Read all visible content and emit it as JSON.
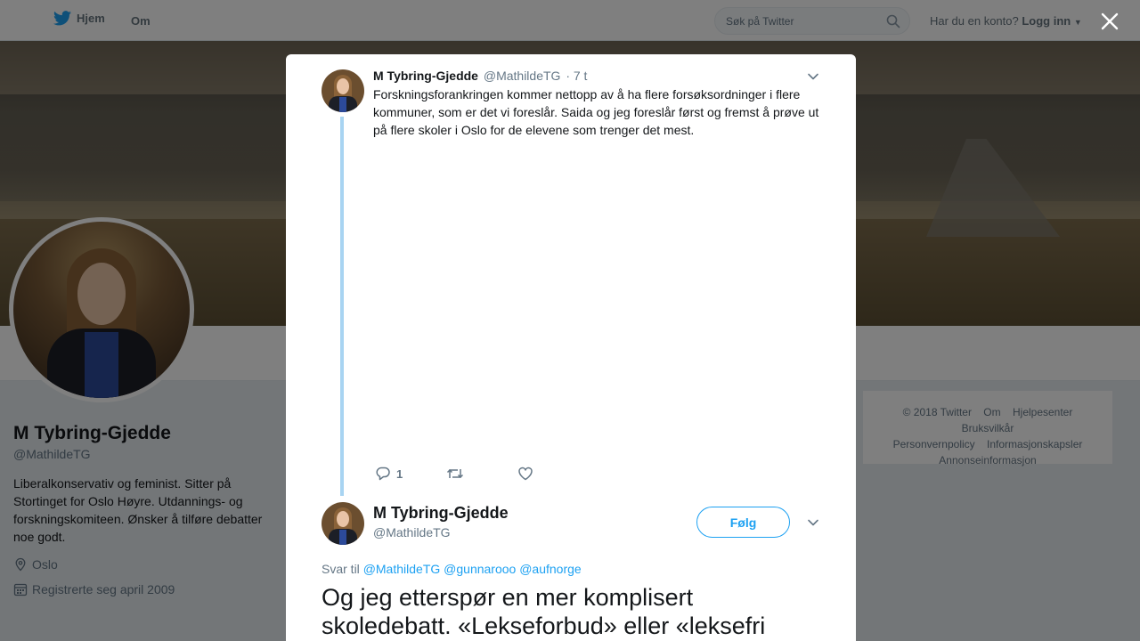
{
  "nav": {
    "home_label": "Hjem",
    "about_label": "Om",
    "search_placeholder": "Søk på Twitter",
    "account_prompt": "Har du en konto?",
    "login_label": "Logg inn"
  },
  "profile": {
    "name": "M Tybring-Gjedde",
    "handle": "@MathildeTG",
    "bio": "Liberalkonservativ og feminist. Sitter på Stortinget for Oslo Høyre. Utdannings- og forskningskomiteen. Ønsker å tilføre debatter noe godt.",
    "location": "Oslo",
    "joined": "Registrerte seg april 2009"
  },
  "footer": {
    "links": [
      "© 2018 Twitter",
      "Om",
      "Hjelpesenter",
      "Bruksvilkår",
      "Personvernpolicy",
      "Informasjonskapsler",
      "Annonseinformasjon"
    ]
  },
  "modal": {
    "tweet1": {
      "name": "M Tybring-Gjedde",
      "handle": "@MathildeTG",
      "time": "· 7 t",
      "text": "Forskningsforankringen kommer nettopp av å ha flere forsøksordninger i flere kommuner, som er det vi foreslår. Saida og jeg foreslår først og fremst å prøve ut på flere skoler i Oslo for de elevene som trenger det mest.",
      "reply_count": "1"
    },
    "tweet2": {
      "name": "M Tybring-Gjedde",
      "handle": "@MathildeTG",
      "follow_label": "Følg",
      "reply_prefix": "Svar til",
      "mentions": [
        "@MathildeTG",
        "@gunnarooo",
        "@aufnorge"
      ],
      "text": "Og jeg etterspør en mer komplisert skoledebatt. «Lekseforbud» eller «leksefri"
    }
  },
  "colors": {
    "brand": "#1da1f2",
    "thread_line": "#a8d4f2",
    "muted_text": "#657786"
  }
}
